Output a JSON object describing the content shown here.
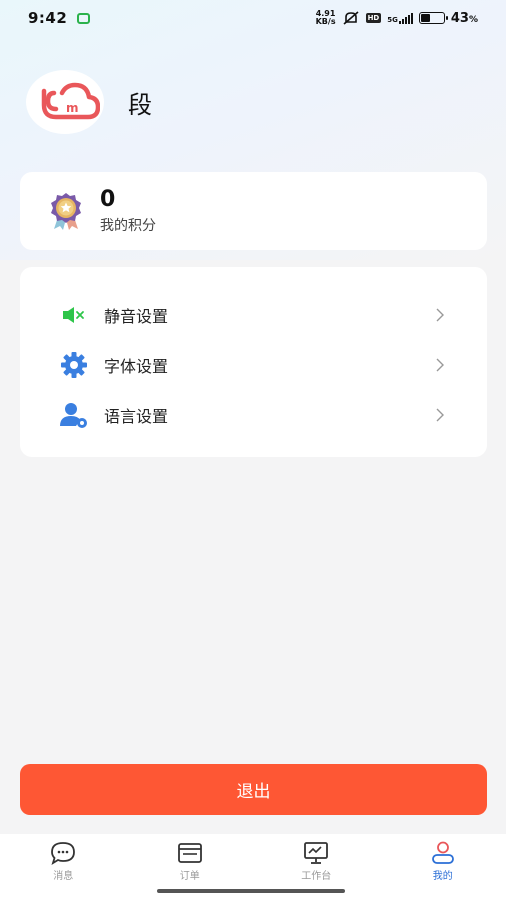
{
  "status_bar": {
    "time": "9:42",
    "net_speed_value": "4.91",
    "net_speed_unit": "KB/s",
    "hd": "HD",
    "network": "5G",
    "battery_percent": "43",
    "battery_suffix": "%",
    "battery_level": 0.43
  },
  "profile": {
    "username": "段"
  },
  "points": {
    "value": "0",
    "label": "我的积分"
  },
  "settings": {
    "items": [
      {
        "label": "静音设置",
        "icon": "speaker-mute-icon"
      },
      {
        "label": "字体设置",
        "icon": "gear-icon"
      },
      {
        "label": "语言设置",
        "icon": "user-settings-icon"
      }
    ]
  },
  "logout": {
    "label": "退出"
  },
  "tabs": [
    {
      "label": "消息",
      "icon": "chat-bubble-icon",
      "active": false
    },
    {
      "label": "订单",
      "icon": "order-card-icon",
      "active": false
    },
    {
      "label": "工作台",
      "icon": "monitor-chart-icon",
      "active": false
    },
    {
      "label": "我的",
      "icon": "person-icon",
      "active": true
    }
  ],
  "colors": {
    "accent": "#fe5734",
    "active_tab": "#2b6fd6",
    "mute_icon": "#2ec54a",
    "settings_icon": "#3a7fe0",
    "logo": "#e9575a"
  }
}
